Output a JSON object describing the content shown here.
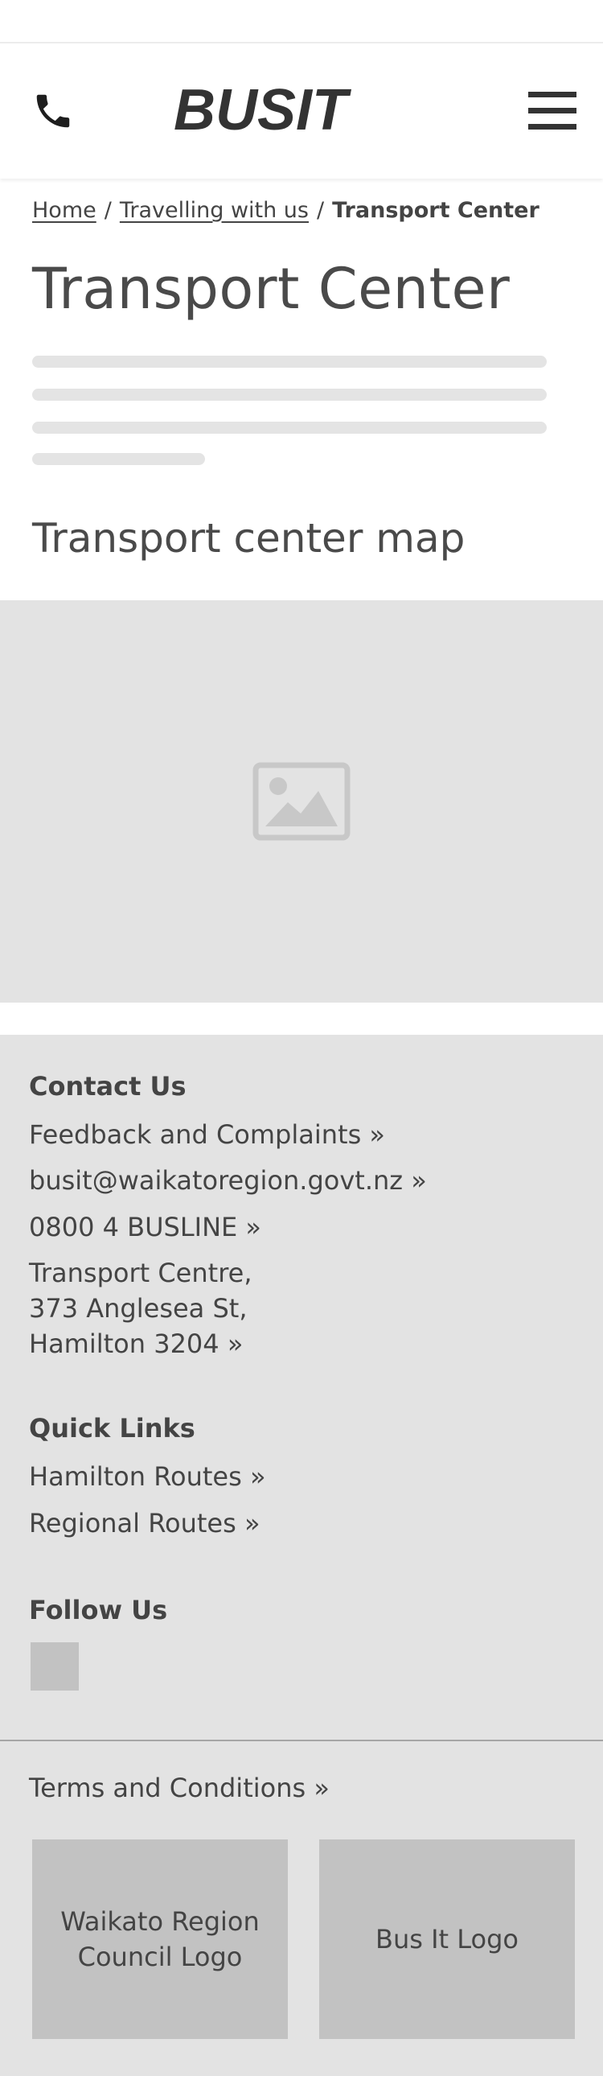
{
  "header": {
    "logo_text": "BUSIT",
    "phone_icon": "phone-icon",
    "menu_icon": "hamburger-menu-icon"
  },
  "breadcrumb": {
    "home": "Home",
    "sep1": "/",
    "travelling": "Travelling with us",
    "sep2": "/",
    "current": "Transport Center"
  },
  "page": {
    "title": "Transport Center",
    "map_heading": "Transport center map",
    "map_icon": "image-placeholder-icon"
  },
  "footer": {
    "contact_heading": "Contact Us",
    "feedback": "Feedback and Complaints »",
    "email": "busit@waikatoregion.govt.nz »",
    "phone": "0800 4 BUSLINE »",
    "address_line1": "Transport Centre,",
    "address_line2": "373 Anglesea St,",
    "address_line3": "Hamilton 3204 »",
    "quick_heading": "Quick Links",
    "hamilton_routes": "Hamilton Routes »",
    "regional_routes": "Regional Routes »",
    "follow_heading": "Follow Us",
    "terms": "Terms and Conditions »",
    "logo1": "Waikato Region Council Logo",
    "logo2": "Bus It Logo"
  },
  "colors": {
    "text": "#444444",
    "placeholder": "#e3e3e3",
    "placeholder_dark": "#c2c2c2"
  }
}
